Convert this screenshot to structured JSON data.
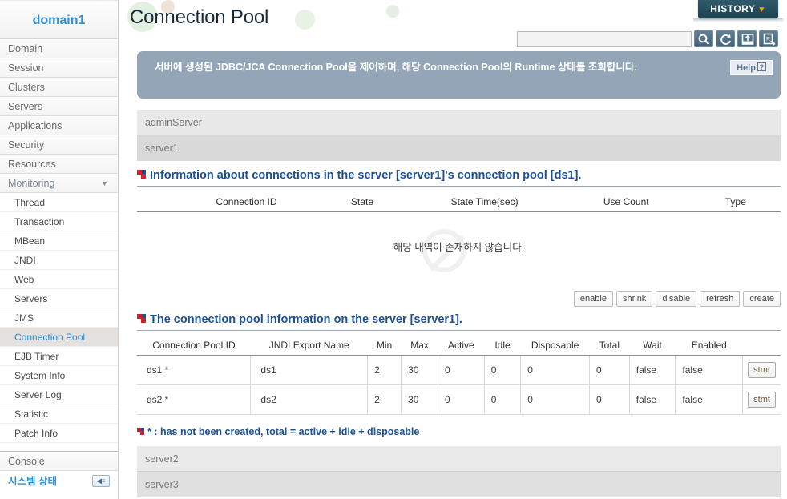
{
  "sidebar": {
    "brand": "domain1",
    "top_items": [
      {
        "label": "Domain",
        "expanded": false
      },
      {
        "label": "Session",
        "expanded": false
      },
      {
        "label": "Clusters",
        "expanded": false
      },
      {
        "label": "Servers",
        "expanded": false
      },
      {
        "label": "Applications",
        "expanded": false
      },
      {
        "label": "Security",
        "expanded": false
      },
      {
        "label": "Resources",
        "expanded": false
      },
      {
        "label": "Monitoring",
        "expanded": true
      }
    ],
    "sub_items": [
      {
        "label": "Thread",
        "active": false
      },
      {
        "label": "Transaction",
        "active": false
      },
      {
        "label": "MBean",
        "active": false
      },
      {
        "label": "JNDI",
        "active": false
      },
      {
        "label": "Web",
        "active": false
      },
      {
        "label": "Servers",
        "active": false
      },
      {
        "label": "JMS",
        "active": false
      },
      {
        "label": "Connection Pool",
        "active": true
      },
      {
        "label": "EJB Timer",
        "active": false
      },
      {
        "label": "System Info",
        "active": false
      },
      {
        "label": "Server Log",
        "active": false
      },
      {
        "label": "Statistic",
        "active": false
      },
      {
        "label": "Patch Info",
        "active": false
      }
    ],
    "console_label": "Console",
    "system_status_label": "시스템 상태"
  },
  "header": {
    "page_title": "Connection Pool",
    "history_label": "HISTORY",
    "history_chevron": "▼",
    "search_placeholder": "",
    "search_value": "",
    "toolbar_icons": [
      "search-icon",
      "refresh-icon",
      "xml-export-icon",
      "report-export-icon"
    ]
  },
  "banner": {
    "text": "서버에 생성된 JDBC/JCA Connection Pool을 제어하며, 해당 Connection Pool의 Runtime 상태를 조회합니다.",
    "help_label": "Help",
    "help_glyph": "?"
  },
  "server_strip_top": [
    {
      "name": "adminServer"
    },
    {
      "name": "server1"
    }
  ],
  "server_strip_bottom": [
    {
      "name": "server2"
    },
    {
      "name": "server3"
    }
  ],
  "section_connections": {
    "heading": "Information about connections in the server [server1]'s connection pool [ds1].",
    "columns": [
      "Connection ID",
      "State",
      "State Time(sec)",
      "Use Count",
      "Type"
    ],
    "rows": [],
    "empty_message": "해당 내역이 존재하지 않습니다."
  },
  "actions": [
    {
      "label": "enable"
    },
    {
      "label": "shrink"
    },
    {
      "label": "disable"
    },
    {
      "label": "refresh"
    },
    {
      "label": "create"
    }
  ],
  "section_pools": {
    "heading": "The connection pool information on the server [server1].",
    "columns": [
      "Connection Pool ID",
      "JNDI Export Name",
      "Min",
      "Max",
      "Active",
      "Idle",
      "Disposable",
      "Total",
      "Wait",
      "Enabled",
      ""
    ],
    "rows": [
      {
        "pool_id": "ds1 *",
        "jndi": "ds1",
        "min": "2",
        "max": "30",
        "active": "0",
        "idle": "0",
        "disposable": "0",
        "total": "0",
        "wait": "false",
        "enabled": "false",
        "stmt_label": "stmt"
      },
      {
        "pool_id": "ds2 *",
        "jndi": "ds2",
        "min": "2",
        "max": "30",
        "active": "0",
        "idle": "0",
        "disposable": "0",
        "total": "0",
        "wait": "false",
        "enabled": "false",
        "stmt_label": "stmt"
      }
    ],
    "footnote": "* : has not been created, total = active + idle + disposable"
  },
  "colors": {
    "brand_blue": "#2f8fd4",
    "heading_blue": "#1b4f96",
    "banner_bg": "#94a5b8",
    "history_bg": "#2e5a6b",
    "history_chevron": "#f6a623",
    "bullet_red": "#d02128",
    "active_item_bg": "#e3e0de"
  }
}
